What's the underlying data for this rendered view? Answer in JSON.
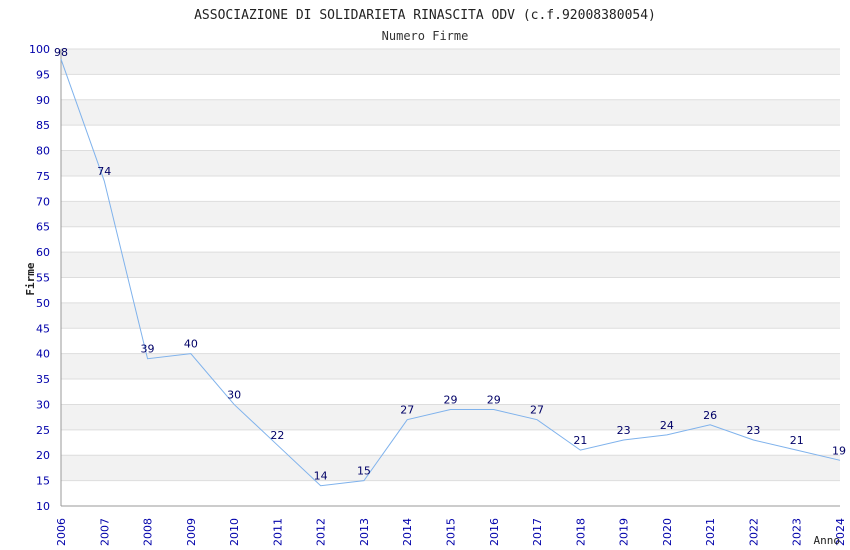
{
  "chart_data": {
    "type": "line",
    "title": "ASSOCIAZIONE DI SOLIDARIETA RINASCITA ODV (c.f.92008380054)",
    "subtitle": "Numero Firme",
    "xlabel": "Anno",
    "ylabel": "Firme",
    "categories": [
      "2006",
      "2007",
      "2008",
      "2009",
      "2010",
      "2011",
      "2012",
      "2013",
      "2014",
      "2015",
      "2016",
      "2017",
      "2018",
      "2019",
      "2020",
      "2021",
      "2022",
      "2023",
      "2024"
    ],
    "values": [
      98,
      74,
      39,
      40,
      30,
      22,
      14,
      15,
      27,
      29,
      29,
      27,
      21,
      23,
      24,
      26,
      23,
      21,
      19
    ],
    "ylim": [
      10,
      100
    ],
    "ytick_step": 5,
    "grid": "horizontal alternating bands",
    "colors": {
      "line": "#7fb2ec",
      "tick_labels": "#0000aa",
      "data_labels": "#000066",
      "band": "#f2f2f2",
      "grid": "#dddddd",
      "axis": "#999999",
      "title": "#222222"
    }
  }
}
